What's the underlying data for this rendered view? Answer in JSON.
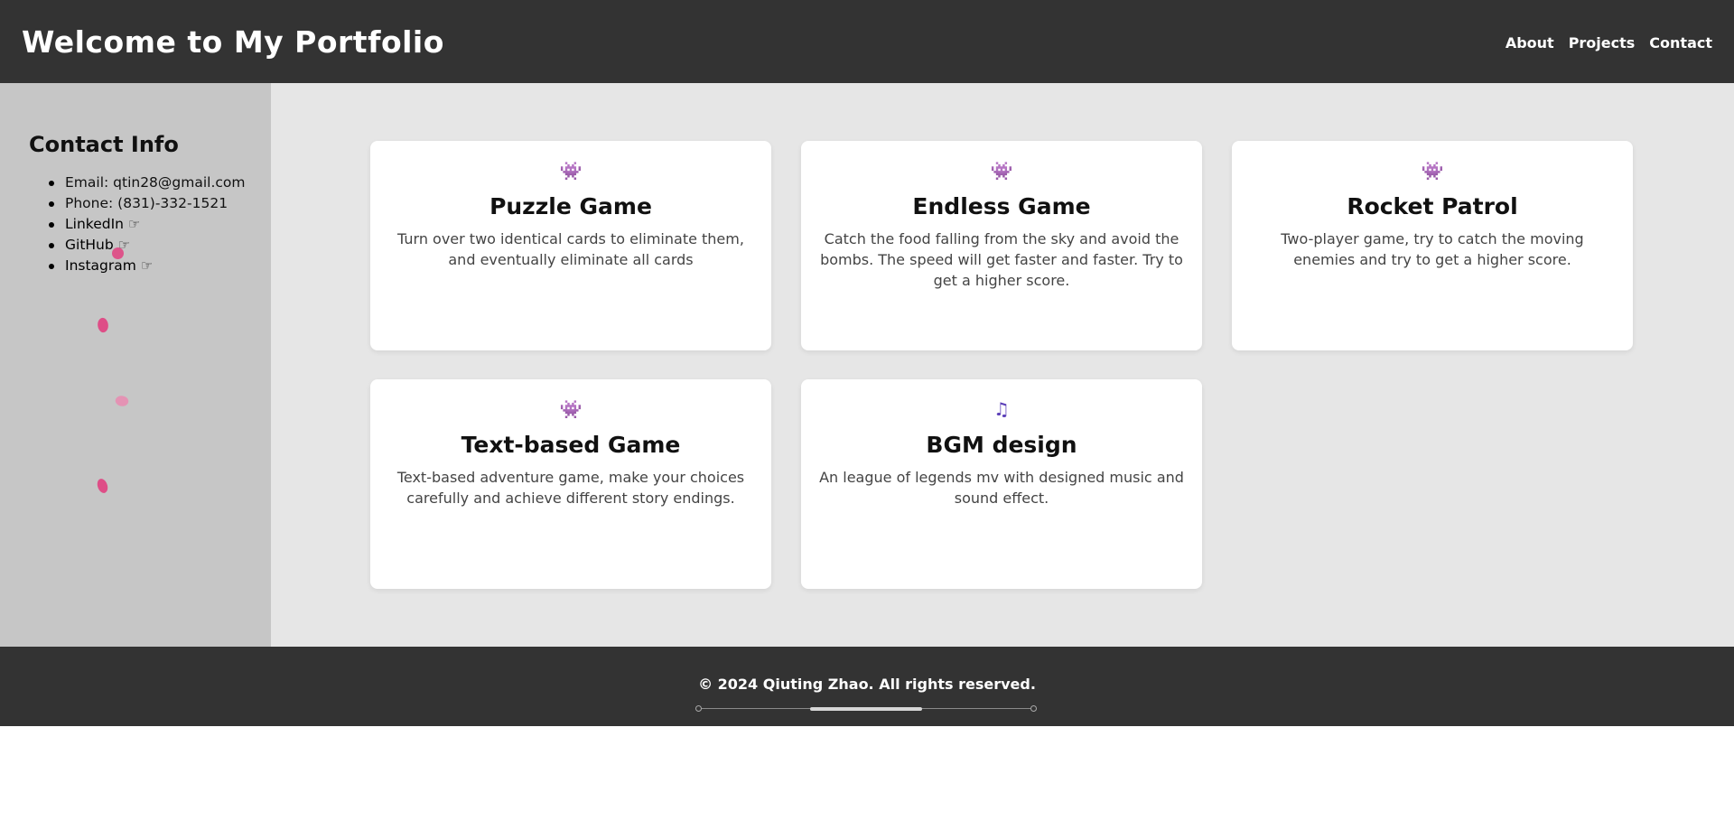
{
  "header": {
    "title": "Welcome to My Portfolio",
    "nav": [
      "About",
      "Projects",
      "Contact"
    ]
  },
  "sidebar": {
    "heading": "Contact Info",
    "items": [
      {
        "label": "Email: qtin28@gmail.com",
        "icon": ""
      },
      {
        "label": "Phone: (831)-332-1521",
        "icon": ""
      },
      {
        "label": "LinkedIn",
        "icon": "pointing-hand-icon"
      },
      {
        "label": "GitHub",
        "icon": "pointing-hand-icon"
      },
      {
        "label": "Instagram",
        "icon": "pointing-hand-icon"
      }
    ]
  },
  "projects": [
    {
      "icon": "alien-monster-icon",
      "title": "Puzzle Game",
      "description": "Turn over two identical cards to eliminate them, and eventually eliminate all cards"
    },
    {
      "icon": "alien-monster-icon",
      "title": "Endless Game",
      "description": "Catch the food falling from the sky and avoid the bombs. The speed will get faster and faster. Try to get a higher score."
    },
    {
      "icon": "alien-monster-icon",
      "title": "Rocket Patrol",
      "description": "Two-player game, try to catch the moving enemies and try to get a higher score."
    },
    {
      "icon": "alien-monster-icon",
      "title": "Text-based Game",
      "description": "Text-based adventure game, make your choices carefully and achieve different story endings."
    },
    {
      "icon": "music-note-icon",
      "title": "BGM design",
      "description": "An league of legends mv with designed music and sound effect."
    }
  ],
  "footer": {
    "text": "© 2024 Qiuting Zhao. All rights reserved."
  },
  "colors": {
    "header_bg": "#333333",
    "sidebar_bg": "#c6c6c6",
    "main_bg": "#e6e6e6",
    "card_bg": "#ffffff",
    "petal": "#e0407f",
    "icon_accent": "#5b3fb8"
  }
}
